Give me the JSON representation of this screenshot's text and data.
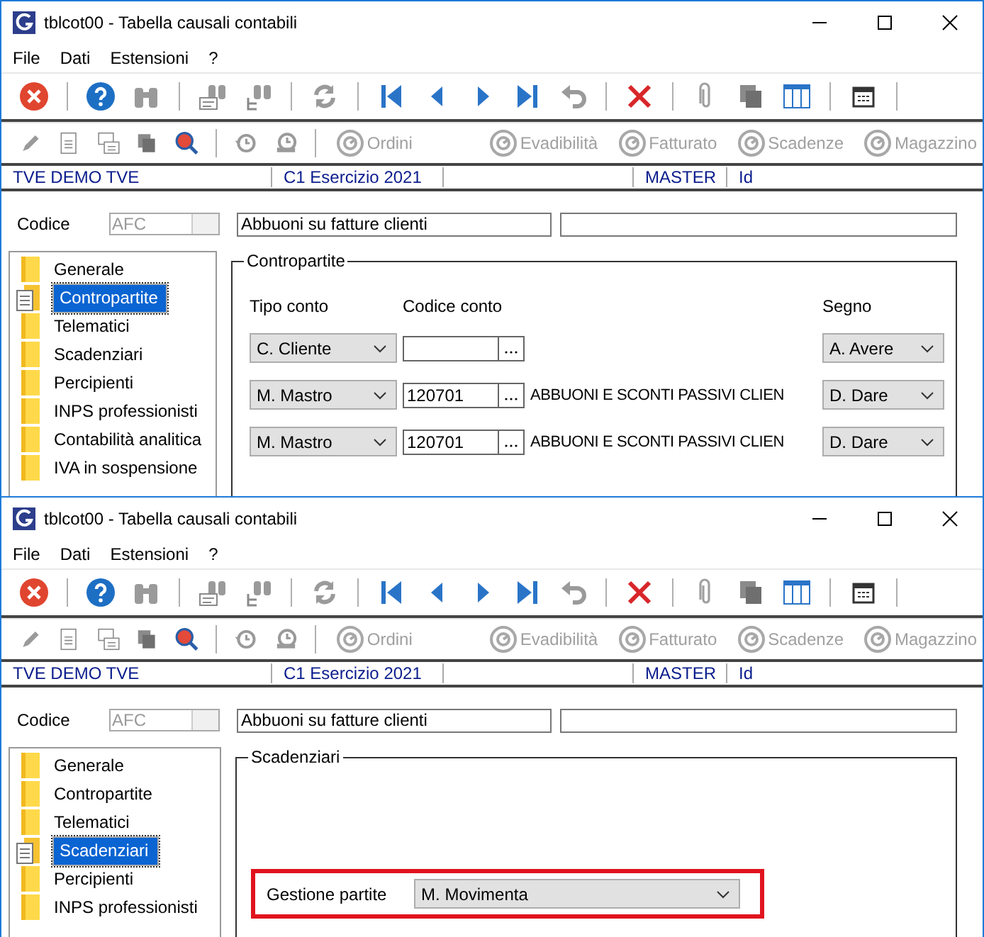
{
  "windows": [
    {
      "title": "tblcot00 - Tabella causali contabili",
      "menu": [
        "File",
        "Dati",
        "Estensioni",
        "?"
      ],
      "toolbar_buttons": [
        {
          "label": "Ordini",
          "disabled": true
        },
        {
          "label": "Evadibilità",
          "disabled": true
        },
        {
          "label": "Fatturato",
          "disabled": true
        },
        {
          "label": "Scadenze",
          "disabled": true
        },
        {
          "label": "Magazzino",
          "disabled": true
        }
      ],
      "status_bar": [
        "TVE DEMO TVE",
        "C1 Esercizio 2021",
        "MASTER",
        "Id"
      ],
      "codice": {
        "label": "Codice",
        "code": "AFC",
        "description": "Abbuoni su fatture clienti"
      },
      "sidebar": [
        {
          "label": "Generale",
          "selected": false
        },
        {
          "label": "Contropartite",
          "selected": true
        },
        {
          "label": "Telematici",
          "selected": false
        },
        {
          "label": "Scadenziari",
          "selected": false
        },
        {
          "label": "Percipienti",
          "selected": false
        },
        {
          "label": "INPS professionisti",
          "selected": false
        },
        {
          "label": "Contabilità analitica",
          "selected": false
        },
        {
          "label": "IVA in sospensione",
          "selected": false
        }
      ],
      "panel": {
        "kind": "grid",
        "title": "Contropartite",
        "columns": [
          "Tipo conto",
          "Codice conto",
          "Segno"
        ],
        "rows": [
          {
            "tipo": "C. Cliente",
            "segno": "A. Avere"
          },
          {
            "tipo": "M. Mastro",
            "codice": "120701",
            "descrizione": "ABBUONI E SCONTI PASSIVI CLIEN",
            "segno": "D. Dare"
          },
          {
            "tipo": "M. Mastro",
            "codice": "120701",
            "descrizione": "ABBUONI E SCONTI PASSIVI CLIEN",
            "segno": "D. Dare"
          }
        ]
      }
    },
    {
      "title": "tblcot00 - Tabella causali contabili",
      "menu": [
        "File",
        "Dati",
        "Estensioni",
        "?"
      ],
      "toolbar_buttons": [
        {
          "label": "Ordini",
          "disabled": true
        },
        {
          "label": "Evadibilità",
          "disabled": true
        },
        {
          "label": "Fatturato",
          "disabled": true
        },
        {
          "label": "Scadenze",
          "disabled": true
        },
        {
          "label": "Magazzino",
          "disabled": true
        }
      ],
      "status_bar": [
        "TVE DEMO TVE",
        "C1 Esercizio 2021",
        "MASTER",
        "Id"
      ],
      "codice": {
        "label": "Codice",
        "code": "AFC",
        "description": "Abbuoni su fatture clienti"
      },
      "sidebar": [
        {
          "label": "Generale",
          "selected": false
        },
        {
          "label": "Contropartite",
          "selected": false
        },
        {
          "label": "Telematici",
          "selected": false
        },
        {
          "label": "Scadenziari",
          "selected": true
        },
        {
          "label": "Percipienti",
          "selected": false
        },
        {
          "label": "INPS professionisti",
          "selected": false
        }
      ],
      "panel": {
        "kind": "fields",
        "title": "Scadenziari",
        "fields": [
          {
            "label": "Gestione partite",
            "value": "M. Movimenta",
            "highlighted": true
          }
        ]
      }
    }
  ]
}
